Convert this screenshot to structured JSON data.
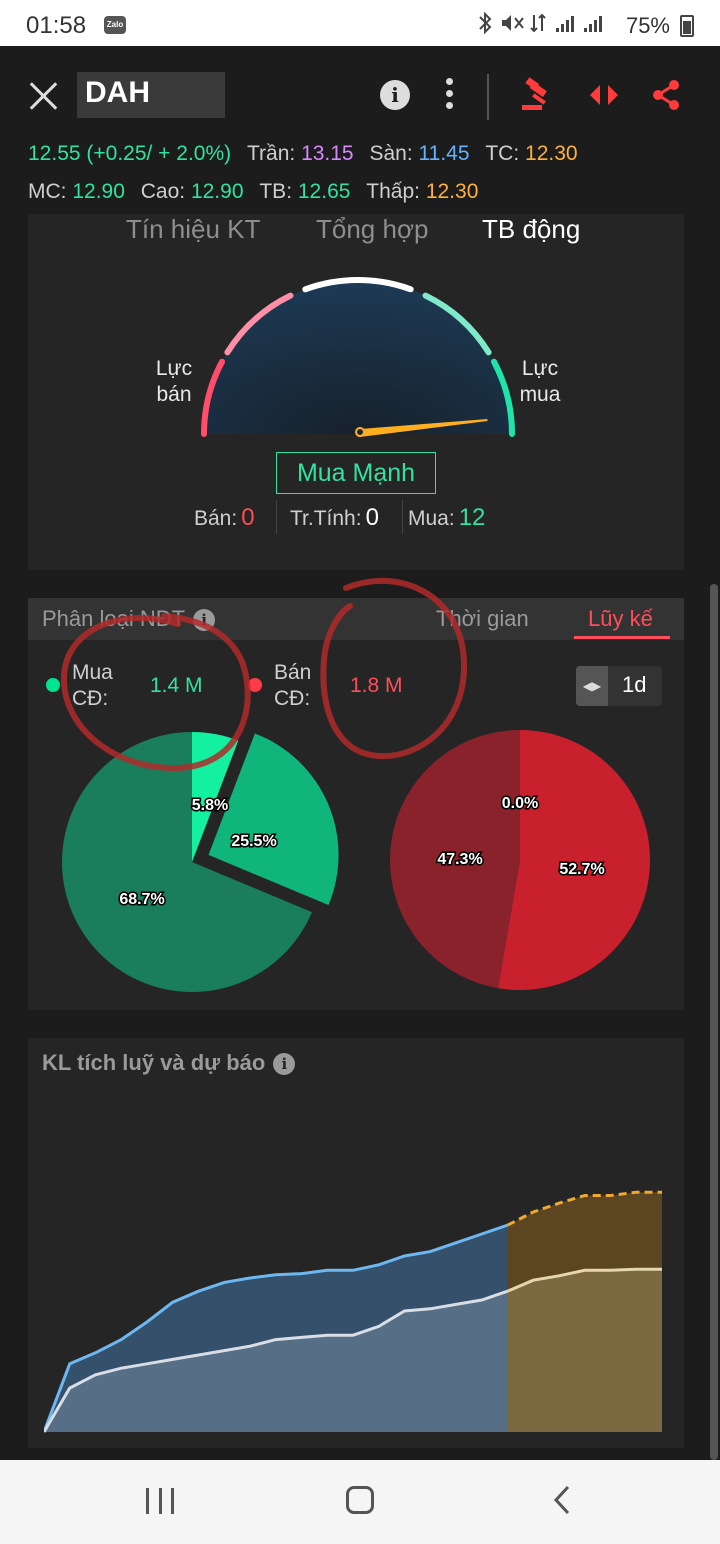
{
  "status_bar": {
    "time": "01:58",
    "notification_app": "Zalo",
    "battery": "75%"
  },
  "header": {
    "symbol": "DAH",
    "info_icon": "info-icon",
    "more_icon": "more-vert-icon",
    "action_icons": [
      "gavel-icon",
      "swap-arrows-icon",
      "share-icon"
    ]
  },
  "quote": {
    "price": "12.55 (+0.25/ + 2.0%)",
    "ceiling_label": "Trần:",
    "ceiling": "13.15",
    "floor_label": "Sàn:",
    "floor": "11.45",
    "ref_label": "TC:",
    "ref": "12.30",
    "match_label": "MC:",
    "match": "12.90",
    "high_label": "Cao:",
    "high": "12.90",
    "avg_label": "TB:",
    "avg": "12.65",
    "low_label": "Thấp:",
    "low": "12.30"
  },
  "signal_card": {
    "tabs": [
      {
        "label": "Tín hiệu KT",
        "active": false
      },
      {
        "label": "Tổng hợp",
        "active": false
      },
      {
        "label": "TB động",
        "active": true
      }
    ],
    "gauge_left_label_1": "Lực",
    "gauge_left_label_2": "bán",
    "gauge_right_label_1": "Lực",
    "gauge_right_label_2": "mua",
    "gauge_level": 0.97,
    "signal": "Mua Mạnh",
    "sell_label": "Bán:",
    "sell_count": "0",
    "neutral_label": "Tr.Tính:",
    "neutral_count": "0",
    "buy_label": "Mua:",
    "buy_count": "12"
  },
  "investor_card": {
    "title": "Phân loại NĐT",
    "tabs": [
      {
        "label": "Thời gian",
        "active": false
      },
      {
        "label": "Lũy kế",
        "active": true
      }
    ],
    "buy_label_1": "Mua",
    "buy_label_2": "CĐ:",
    "buy_value": "1.4 M",
    "sell_label_1": "Bán",
    "sell_label_2": "CĐ:",
    "sell_value": "1.8 M",
    "period": "1d",
    "colors": {
      "buy": "#00e38f",
      "sell": "#ff3b47"
    }
  },
  "chart_data": [
    {
      "type": "pie",
      "name_hint": "buy",
      "slices": [
        {
          "label": "5.8%",
          "value": 5.8,
          "color": "#12f0a0"
        },
        {
          "label": "25.5%",
          "value": 25.5,
          "color": "#10b57c"
        },
        {
          "label": "68.7%",
          "value": 68.7,
          "color": "#1a7d5c"
        }
      ]
    },
    {
      "type": "pie",
      "name_hint": "sell",
      "slices": [
        {
          "label": "0.0%",
          "value": 0.0,
          "color": "#d12633"
        },
        {
          "label": "52.7%",
          "value": 52.7,
          "color": "#c8202c"
        },
        {
          "label": "47.3%",
          "value": 47.3,
          "color": "#8a222c"
        }
      ]
    },
    {
      "type": "area",
      "title": "KL tích luỹ và dự báo",
      "x": [
        0,
        1,
        2,
        3,
        4,
        5,
        6,
        7,
        8,
        9,
        10,
        11,
        12,
        13,
        14,
        15,
        16,
        17,
        18,
        19,
        20,
        21,
        22,
        23,
        24
      ],
      "series": [
        {
          "values": [
            0,
            62,
            72,
            84,
            100,
            118,
            128,
            136,
            140,
            143,
            144,
            147,
            147,
            152,
            160,
            164,
            172,
            180,
            188,
            200,
            208,
            215,
            215,
            218,
            218
          ],
          "color": "#6db8f0"
        },
        {
          "values": [
            0,
            40,
            52,
            58,
            62,
            66,
            70,
            74,
            78,
            84,
            86,
            88,
            88,
            96,
            110,
            112,
            116,
            120,
            128,
            138,
            142,
            147,
            147,
            148,
            148
          ],
          "color": "#d8dde6"
        }
      ],
      "forecast_start_index": 18,
      "forecast_color": "#f0a830"
    }
  ]
}
